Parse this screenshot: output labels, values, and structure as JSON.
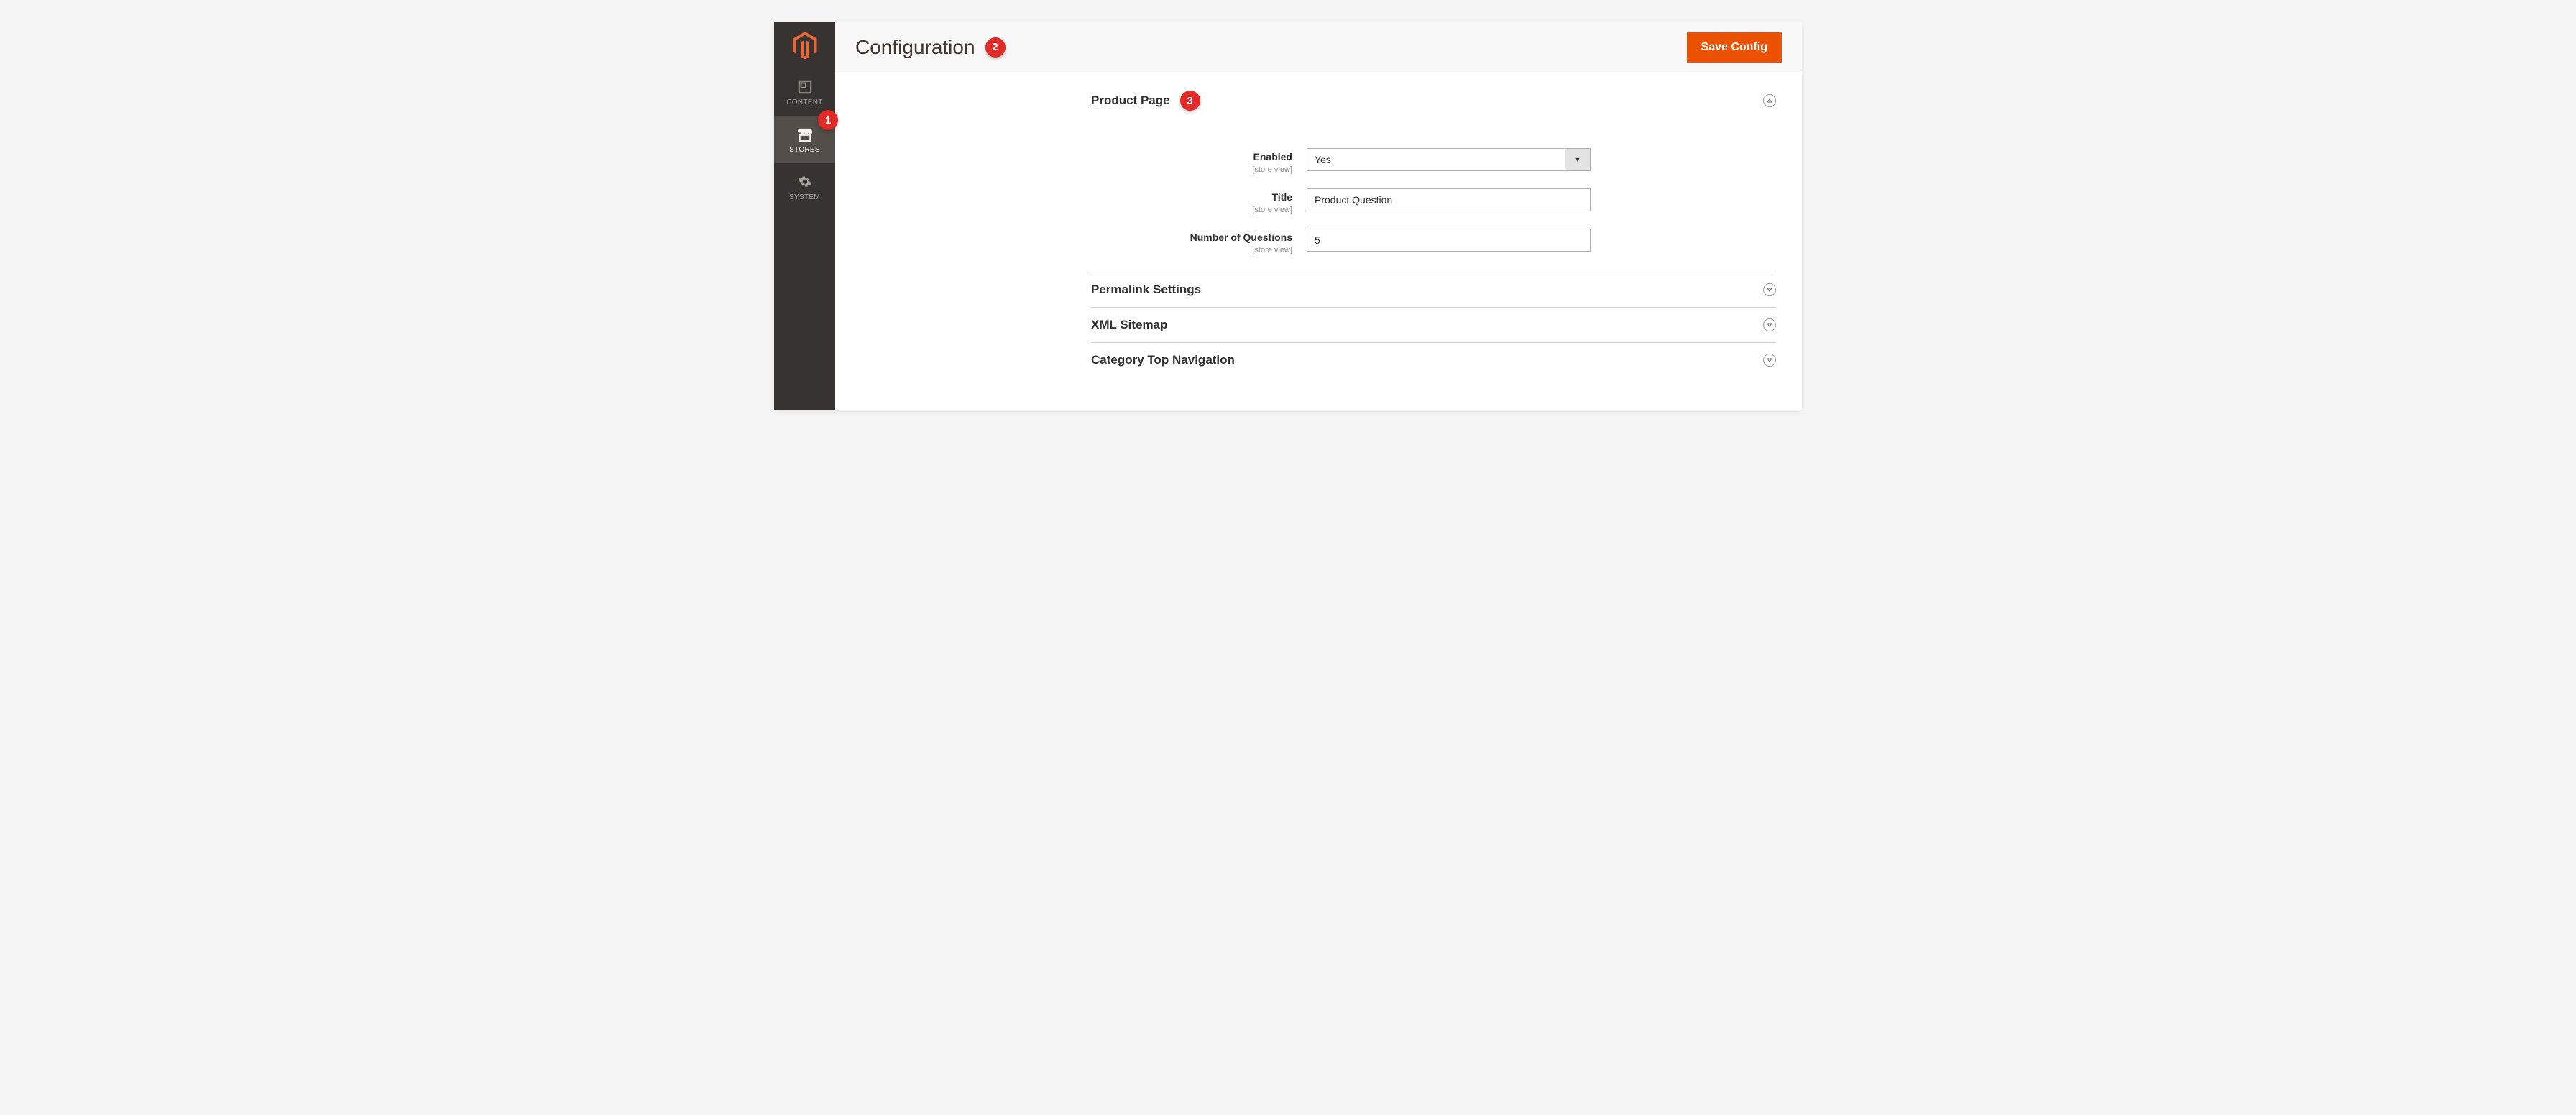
{
  "sidebar": {
    "items": [
      {
        "label": "CONTENT"
      },
      {
        "label": "STORES"
      },
      {
        "label": "SYSTEM"
      }
    ]
  },
  "header": {
    "title": "Configuration",
    "save_label": "Save Config"
  },
  "badges": {
    "b1": "1",
    "b2": "2",
    "b3": "3"
  },
  "sections": {
    "product_page": {
      "title": "Product Page",
      "fields": {
        "enabled": {
          "label": "Enabled",
          "scope": "[store view]",
          "value": "Yes"
        },
        "title": {
          "label": "Title",
          "scope": "[store view]",
          "value": "Product Question"
        },
        "num_questions": {
          "label": "Number of Questions",
          "scope": "[store view]",
          "value": "5"
        }
      }
    },
    "permalink": {
      "title": "Permalink Settings"
    },
    "xml_sitemap": {
      "title": "XML Sitemap"
    },
    "category_nav": {
      "title": "Category Top Navigation"
    }
  }
}
